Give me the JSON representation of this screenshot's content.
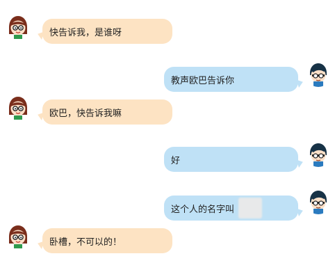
{
  "messages": [
    {
      "side": "left",
      "text": "快告诉我，是谁呀",
      "avatar": "girl-avatar"
    },
    {
      "side": "right",
      "text": "教声欧巴告诉你",
      "avatar": "boy-avatar"
    },
    {
      "side": "left",
      "text": "欧巴，快告诉我嘛",
      "avatar": "girl-avatar"
    },
    {
      "side": "right",
      "text": "好",
      "avatar": "boy-avatar"
    },
    {
      "side": "right",
      "text": "这个人的名字叫",
      "avatar": "boy-avatar"
    },
    {
      "side": "left",
      "text": "卧槽，不可以的！",
      "avatar": "girl-avatar"
    }
  ],
  "colors": {
    "left_bubble": "#fde3c3",
    "right_bubble": "#bfe1f6"
  }
}
